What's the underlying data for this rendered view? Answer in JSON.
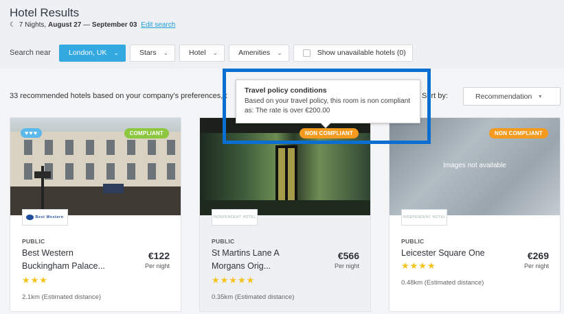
{
  "header": {
    "title": "Hotel Results",
    "nights_prefix": "7 Nights,",
    "date_from": "August 27",
    "date_sep": "—",
    "date_to": "September 03",
    "edit_link": "Edit search"
  },
  "filters": {
    "search_near_label": "Search near",
    "location": "London, UK",
    "stars": "Stars",
    "hotel": "Hotel",
    "amenities": "Amenities",
    "show_unavailable": "Show unavailable hotels (0)"
  },
  "results": {
    "count_text": "33 recommended hotels based on your company's preferences, t",
    "sort_label": "Sort by:",
    "sort_value": "Recommendation"
  },
  "tooltip": {
    "title": "Travel policy conditions",
    "body": "Based on your travel policy, this room is non compliant as: The rate is over €200.00"
  },
  "cards": [
    {
      "badge": "COMPLIANT",
      "logo": "Best Western",
      "type": "PUBLIC",
      "name_line1": "Best Western",
      "name_line2": "Buckingham Palace...",
      "price": "€122",
      "per_night": "Per night",
      "stars": "★★★",
      "distance": "2.1km (Estimated distance)"
    },
    {
      "badge": "NON COMPLIANT",
      "logo": "INDEPENDENT HOTEL",
      "type": "PUBLIC",
      "name_line1": "St Martins Lane A",
      "name_line2": "Morgans Orig...",
      "price": "€566",
      "per_night": "Per night",
      "stars": "★★★★★",
      "distance": "0.35km (Estimated distance)"
    },
    {
      "badge": "NON COMPLIANT",
      "logo": "INDEPENDENT HOTEL",
      "no_image": "Images not available",
      "type": "PUBLIC",
      "name_line1": "Leicester Square One",
      "price": "€269",
      "per_night": "Per night",
      "stars": "★★★★",
      "distance": "0.48km (Estimated distance)"
    }
  ],
  "colors": {
    "accent": "#34a9e0",
    "compliant": "#8dc63f",
    "non_compliant": "#f39a1f",
    "stars": "#f5c21a",
    "highlight": "#0a6fd0"
  }
}
